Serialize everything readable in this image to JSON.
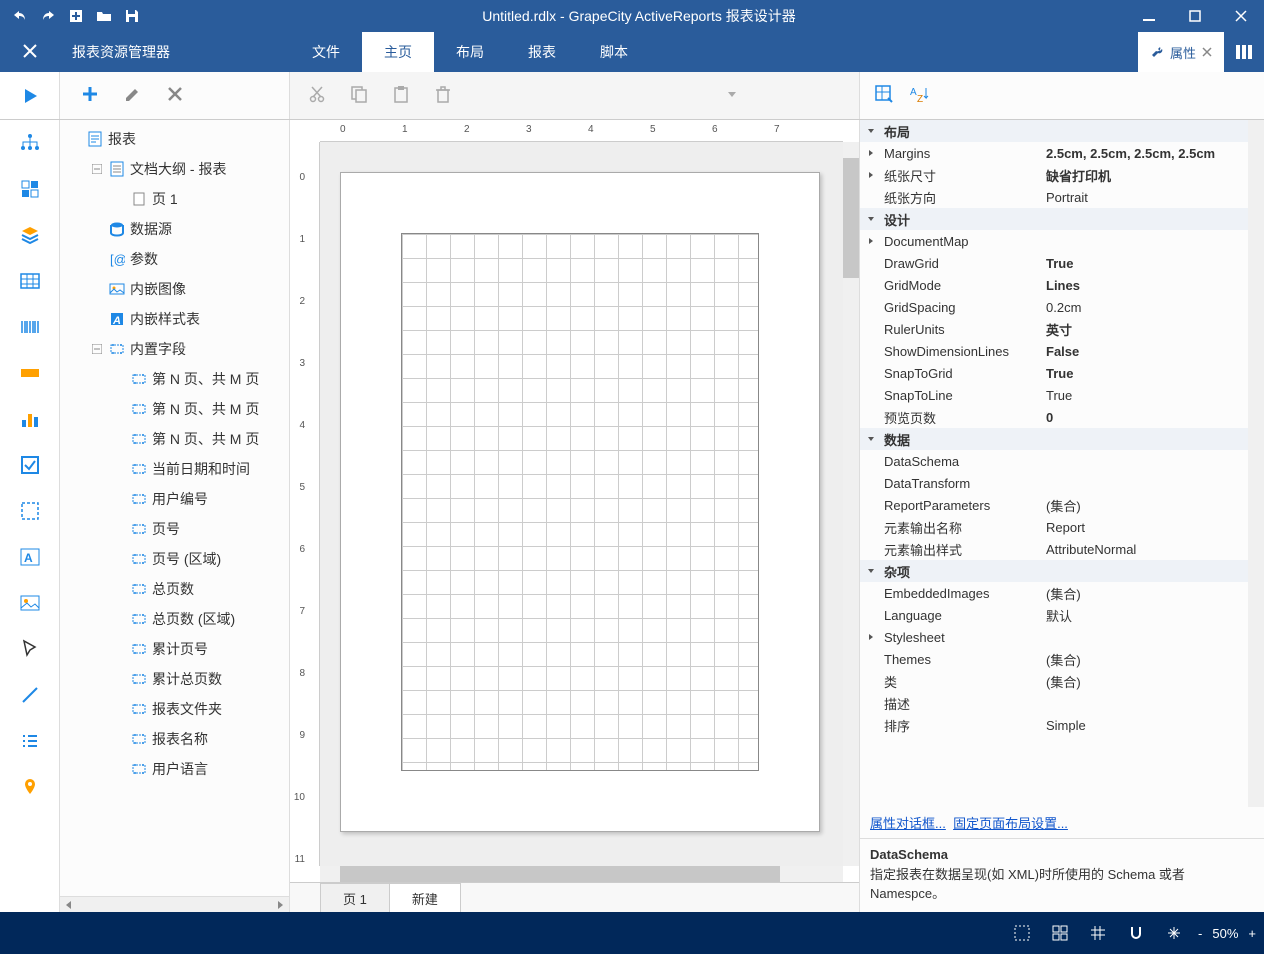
{
  "title": "Untitled.rdlx - GrapeCity ActiveReports 报表设计器",
  "explorer_title": "报表资源管理器",
  "menu_tabs": {
    "file": "文件",
    "home": "主页",
    "layout": "布局",
    "report": "报表",
    "script": "脚本"
  },
  "active_tab": "home",
  "prop_tab_label": "属性",
  "tree": [
    {
      "label": "报表",
      "depth": 0,
      "icon": "report-icon",
      "tw": ""
    },
    {
      "label": "文档大纲 - 报表",
      "depth": 1,
      "icon": "doc-outline-icon",
      "tw": "minus"
    },
    {
      "label": "页 1",
      "depth": 2,
      "icon": "page-icon",
      "tw": ""
    },
    {
      "label": "数据源",
      "depth": 1,
      "icon": "datasource-icon",
      "tw": ""
    },
    {
      "label": "参数",
      "depth": 1,
      "icon": "params-icon",
      "tw": ""
    },
    {
      "label": "内嵌图像",
      "depth": 1,
      "icon": "embedded-image-icon",
      "tw": ""
    },
    {
      "label": "内嵌样式表",
      "depth": 1,
      "icon": "stylesheet-icon",
      "tw": ""
    },
    {
      "label": "内置字段",
      "depth": 1,
      "icon": "builtin-fields-icon",
      "tw": "minus"
    },
    {
      "label": "第 N 页、共 M 页",
      "depth": 2,
      "icon": "field-icon",
      "tw": ""
    },
    {
      "label": "第 N 页、共 M 页",
      "depth": 2,
      "icon": "field-icon",
      "tw": ""
    },
    {
      "label": "第 N 页、共 M 页",
      "depth": 2,
      "icon": "field-icon",
      "tw": ""
    },
    {
      "label": "当前日期和时间",
      "depth": 2,
      "icon": "field-icon",
      "tw": ""
    },
    {
      "label": "用户编号",
      "depth": 2,
      "icon": "field-icon",
      "tw": ""
    },
    {
      "label": "页号",
      "depth": 2,
      "icon": "field-icon",
      "tw": ""
    },
    {
      "label": "页号 (区域)",
      "depth": 2,
      "icon": "field-icon",
      "tw": ""
    },
    {
      "label": "总页数",
      "depth": 2,
      "icon": "field-icon",
      "tw": ""
    },
    {
      "label": "总页数 (区域)",
      "depth": 2,
      "icon": "field-icon",
      "tw": ""
    },
    {
      "label": "累计页号",
      "depth": 2,
      "icon": "field-icon",
      "tw": ""
    },
    {
      "label": "累计总页数",
      "depth": 2,
      "icon": "field-icon",
      "tw": ""
    },
    {
      "label": "报表文件夹",
      "depth": 2,
      "icon": "field-icon",
      "tw": ""
    },
    {
      "label": "报表名称",
      "depth": 2,
      "icon": "field-icon",
      "tw": ""
    },
    {
      "label": "用户语言",
      "depth": 2,
      "icon": "field-icon",
      "tw": ""
    }
  ],
  "design_tabs": {
    "page1": "页 1",
    "new": "新建"
  },
  "properties": {
    "categories": [
      {
        "name": "布局",
        "rows": [
          {
            "n": "Margins",
            "v": "2.5cm, 2.5cm, 2.5cm, 2.5cm",
            "bold": true,
            "exp": true
          },
          {
            "n": "纸张尺寸",
            "v": "缺省打印机",
            "bold": true,
            "exp": true
          },
          {
            "n": "纸张方向",
            "v": "Portrait",
            "bold": false
          }
        ]
      },
      {
        "name": "设计",
        "rows": [
          {
            "n": "DocumentMap",
            "v": "",
            "exp": true
          },
          {
            "n": "DrawGrid",
            "v": "True",
            "bold": true
          },
          {
            "n": "GridMode",
            "v": "Lines",
            "bold": true
          },
          {
            "n": "GridSpacing",
            "v": "0.2cm"
          },
          {
            "n": "RulerUnits",
            "v": "英寸",
            "bold": true
          },
          {
            "n": "ShowDimensionLines",
            "v": "False",
            "bold": true
          },
          {
            "n": "SnapToGrid",
            "v": "True",
            "bold": true
          },
          {
            "n": "SnapToLine",
            "v": "True"
          },
          {
            "n": "预览页数",
            "v": "0",
            "bold": true
          }
        ]
      },
      {
        "name": "数据",
        "rows": [
          {
            "n": "DataSchema",
            "v": ""
          },
          {
            "n": "DataTransform",
            "v": ""
          },
          {
            "n": "ReportParameters",
            "v": "(集合)"
          },
          {
            "n": "元素输出名称",
            "v": "Report"
          },
          {
            "n": "元素输出样式",
            "v": "AttributeNormal"
          }
        ]
      },
      {
        "name": "杂项",
        "rows": [
          {
            "n": "EmbeddedImages",
            "v": "(集合)"
          },
          {
            "n": "Language",
            "v": "默认"
          },
          {
            "n": "Stylesheet",
            "v": "",
            "exp": true
          },
          {
            "n": "Themes",
            "v": "(集合)"
          },
          {
            "n": "类",
            "v": "(集合)"
          },
          {
            "n": "描述",
            "v": ""
          },
          {
            "n": "排序",
            "v": "Simple"
          }
        ]
      }
    ],
    "links": {
      "a": "属性对话框...",
      "b": "固定页面布局设置..."
    },
    "desc": {
      "title": "DataSchema",
      "body": "指定报表在数据呈现(如 XML)时所使用的 Schema 或者 Namespce。"
    }
  },
  "status": {
    "zoom": "50%"
  },
  "ruler_h": [
    "0",
    "1",
    "2",
    "3",
    "4",
    "5",
    "6",
    "7"
  ],
  "ruler_v": [
    "0",
    "1",
    "2",
    "3",
    "4",
    "5",
    "6",
    "7",
    "8",
    "9",
    "10",
    "11"
  ]
}
